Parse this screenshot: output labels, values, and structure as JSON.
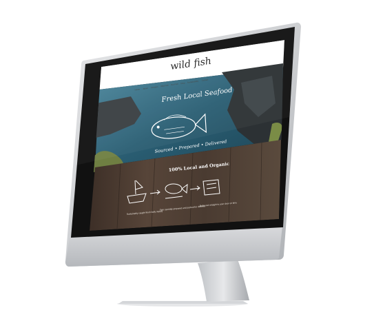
{
  "product": {
    "device": "desktop monitor mockup"
  },
  "site": {
    "logo_text": "wild fish",
    "nav": [
      "Home",
      "About",
      "Recipes",
      "Wild Fish",
      "Our Fish",
      "Shop",
      "Sustainability",
      "Contact"
    ],
    "hero": {
      "headline": "Fresh Local Seafood",
      "subline": "Sourced • Prepared • Delivered"
    },
    "section_title": "100% Local and Organic",
    "steps": [
      {
        "caption": "Sustainably caught fresh daily supply",
        "icon": "boat-icon"
      },
      {
        "caption": "Fish carefully prepared and packed for delivery",
        "icon": "fish-prep-icon"
      },
      {
        "caption": "Delivered straight to your door on time",
        "icon": "delivery-icon"
      }
    ]
  },
  "colors": {
    "bezel": "#111111",
    "frame": "#c9cbce",
    "sea": "#2a5e73",
    "rocks": "#2c3134",
    "wood": "#4a3b31"
  }
}
